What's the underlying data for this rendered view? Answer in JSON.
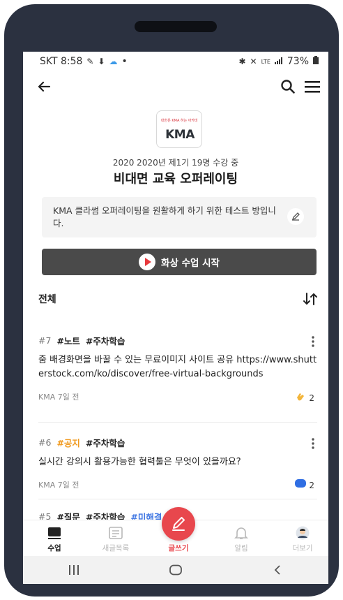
{
  "status_bar": {
    "carrier_time": "SKT 8:58",
    "dot": "•",
    "battery": "73%",
    "network": "LTE"
  },
  "app_bar": {
    "back_icon": "arrow-left-icon",
    "search_icon": "search-icon",
    "menu_icon": "hamburger-icon"
  },
  "course": {
    "logo_text": "KMA",
    "logo_top_text": "대한은 KMA 하는 아카데미",
    "meta": "2020 2020년 제1기 19명 수강 중",
    "title": "비대면 교육 오퍼레이팅",
    "description": "KMA 클라썸 오퍼레이팅을 원활하게 하기 위한 테스트 방입니다."
  },
  "video_button": {
    "label": "화상 수업 시작"
  },
  "list": {
    "heading": "전체"
  },
  "posts": [
    {
      "num": "#7",
      "tags": [
        "#노트",
        "#주차학습"
      ],
      "body": "줌 배경화면을 바꿀 수 있는 무료이미지 사이트 공유 https://www.shutterstock.com/ko/discover/free-virtual-backgrounds",
      "author_time": "KMA 7일 전",
      "reaction_icon": "clap-icon",
      "reaction_count": "2"
    },
    {
      "num": "#6",
      "tags": [
        "#공지",
        "#주차학습"
      ],
      "body": "실시간 강의시 활용가능한 협력툴은 무엇이 있을까요?",
      "author_time": "KMA 7일 전",
      "reaction_icon": "comment-icon",
      "reaction_count": "2"
    },
    {
      "num": "#5",
      "tags": [
        "#질문",
        "#주차학습",
        "#미해결"
      ]
    }
  ],
  "bottom_nav": {
    "items": [
      {
        "label": "수업",
        "icon": "class-icon"
      },
      {
        "label": "새글목록",
        "icon": "new-posts-icon"
      },
      {
        "label": "글쓰기",
        "icon": "pencil-icon"
      },
      {
        "label": "알림",
        "icon": "bell-icon"
      },
      {
        "label": "더보기",
        "icon": "avatar-icon"
      }
    ]
  },
  "system_nav": {
    "recent": "III",
    "home": "○",
    "back": "<"
  },
  "colors": {
    "accent_red": "#e8474d",
    "tag_orange": "#f09a1f",
    "tag_blue": "#4178e3",
    "button_dark": "#4a4a4a",
    "phone_frame": "#2b3140"
  }
}
